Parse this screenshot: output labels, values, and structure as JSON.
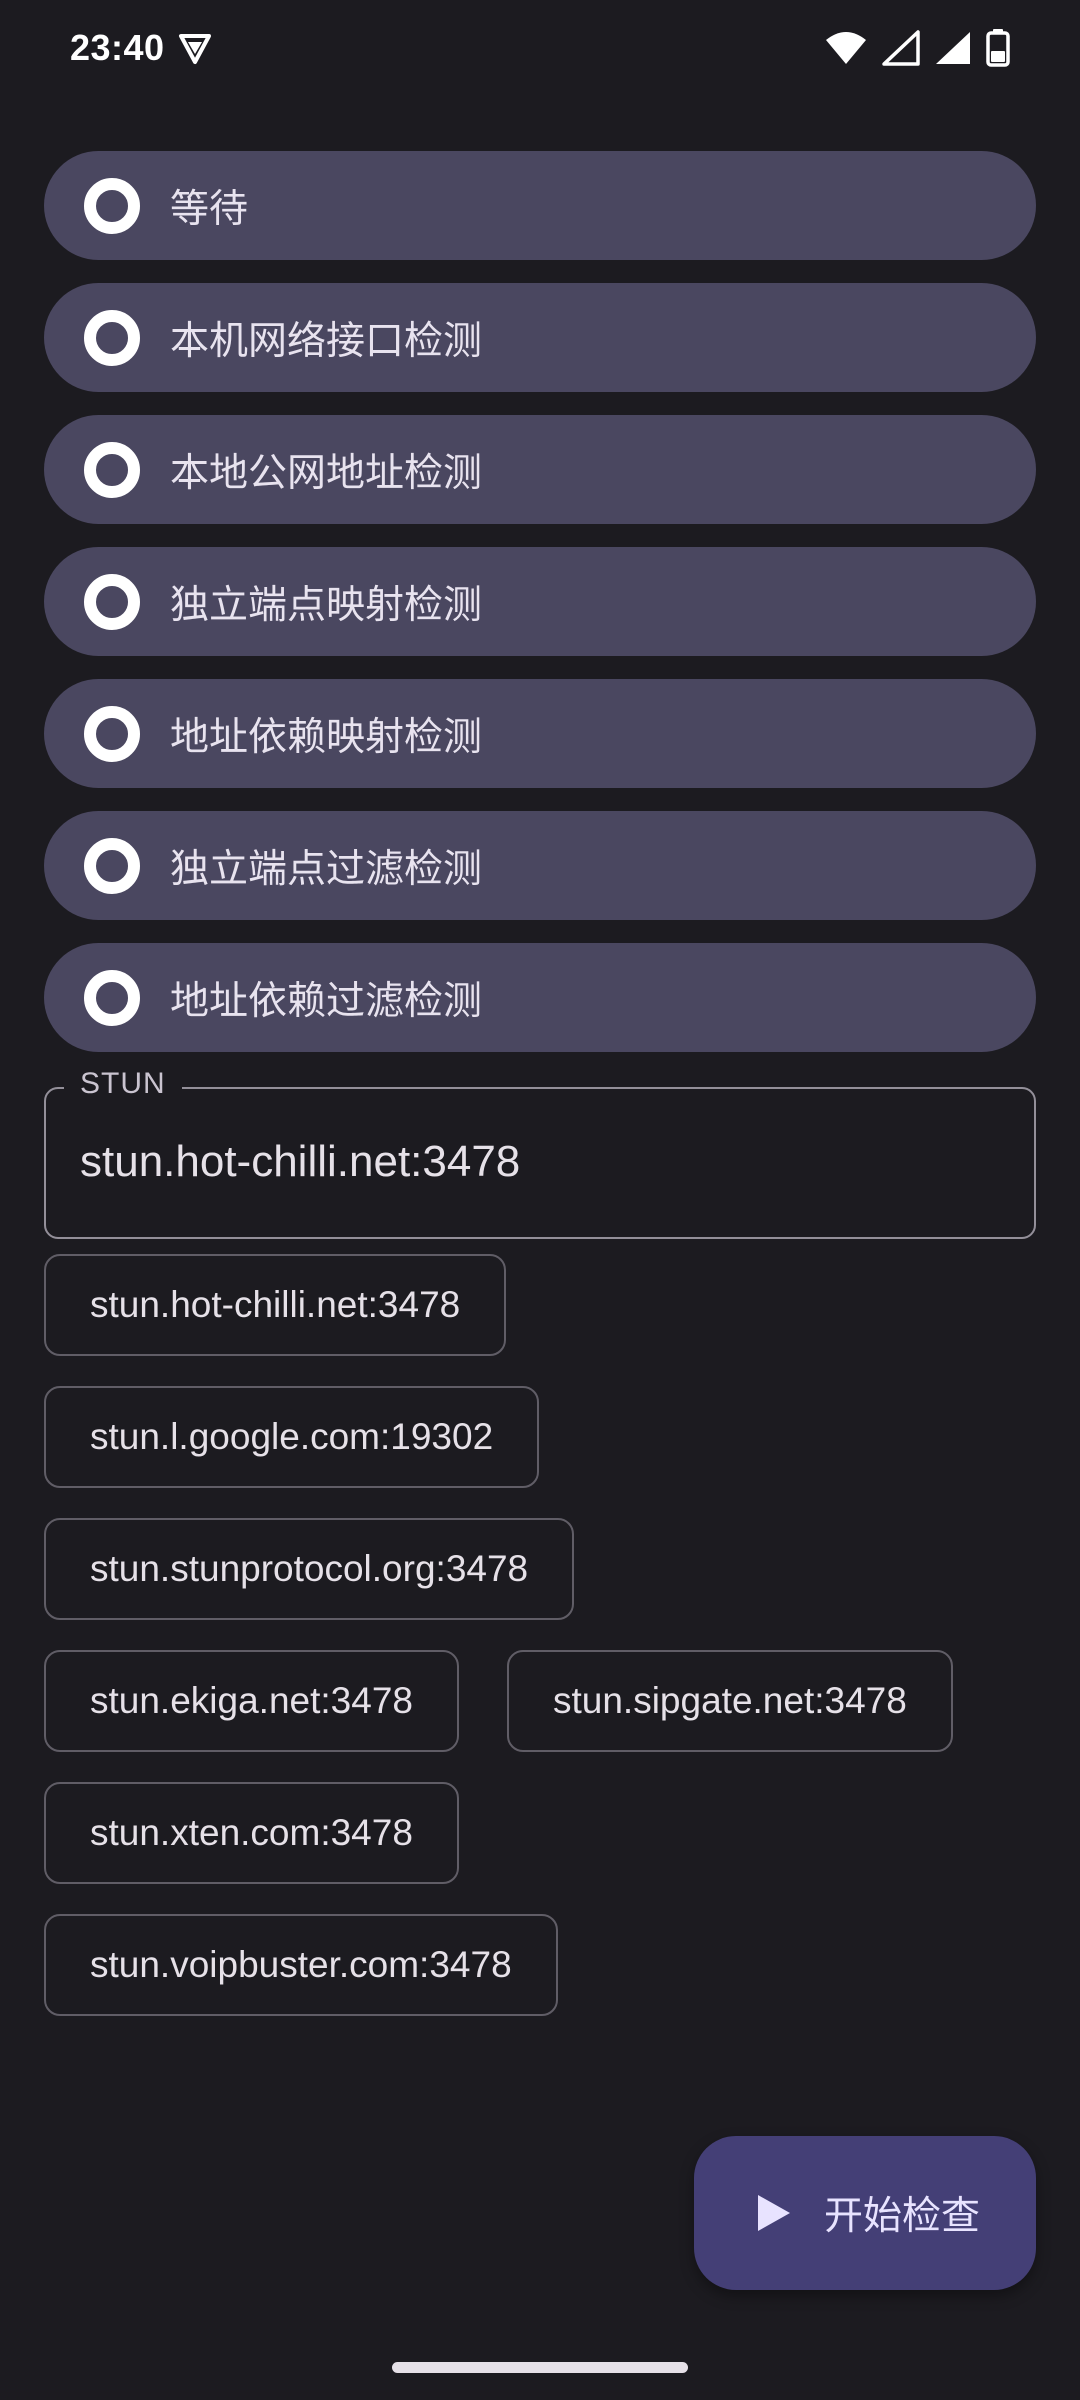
{
  "status_bar": {
    "time": "23:40",
    "icons": [
      "shield-vpn-icon",
      "wifi-icon",
      "signal-icon",
      "signal-icon-2",
      "battery-icon"
    ]
  },
  "steps": [
    {
      "label": "等待"
    },
    {
      "label": "本机网络接口检测"
    },
    {
      "label": "本地公网地址检测"
    },
    {
      "label": "独立端点映射检测"
    },
    {
      "label": "地址依赖映射检测"
    },
    {
      "label": "独立端点过滤检测"
    },
    {
      "label": "地址依赖过滤检测"
    }
  ],
  "stun": {
    "label": "STUN",
    "value": "stun.hot-chilli.net:3478"
  },
  "servers": [
    "stun.hot-chilli.net:3478",
    "stun.l.google.com:19302",
    "stun.stunprotocol.org:3478",
    "stun.ekiga.net:3478",
    "stun.sipgate.net:3478",
    "stun.xten.com:3478",
    "stun.voipbuster.com:3478"
  ],
  "fab": {
    "label": "开始检查",
    "icon": "play-icon"
  },
  "colors": {
    "background": "#1c1b20",
    "step_bg": "#4a4760",
    "fab_bg": "#443f76",
    "outline": "#938f99"
  }
}
